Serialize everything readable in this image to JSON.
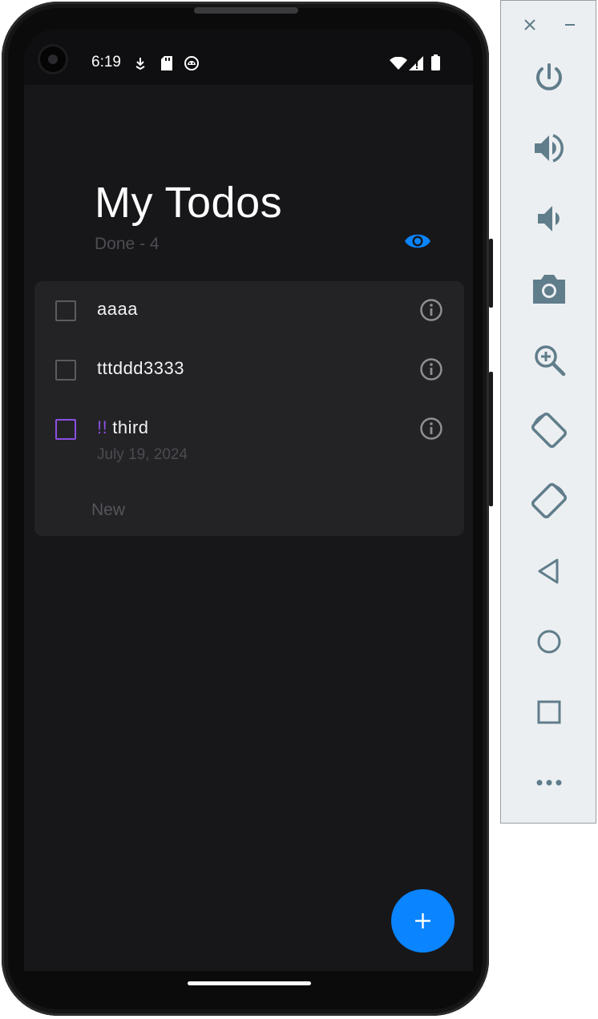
{
  "status_bar": {
    "time": "6:19"
  },
  "app": {
    "title": "My Todos",
    "done_label": "Done - 4",
    "accent_color": "#0a84ff",
    "priority_color": "#8a4fe0"
  },
  "todos": [
    {
      "text": "aaaa",
      "priority": "",
      "date": "",
      "checked": false
    },
    {
      "text": "tttddd3333",
      "priority": "",
      "date": "",
      "checked": false
    },
    {
      "text": "third",
      "priority": "!!",
      "date": "July 19, 2024",
      "checked": false
    }
  ],
  "new_todo": {
    "placeholder": "New",
    "value": ""
  },
  "fab": {
    "label": "+"
  },
  "emulator_panel": {
    "window_controls": [
      "close-icon",
      "minimize-icon"
    ],
    "buttons": [
      "power-icon",
      "volume-up-icon",
      "volume-down-icon",
      "camera-icon",
      "zoom-icon",
      "rotate-left-icon",
      "rotate-right-icon",
      "back-icon",
      "home-icon",
      "overview-icon",
      "more-icon"
    ],
    "icon_color": "#607d8b"
  }
}
